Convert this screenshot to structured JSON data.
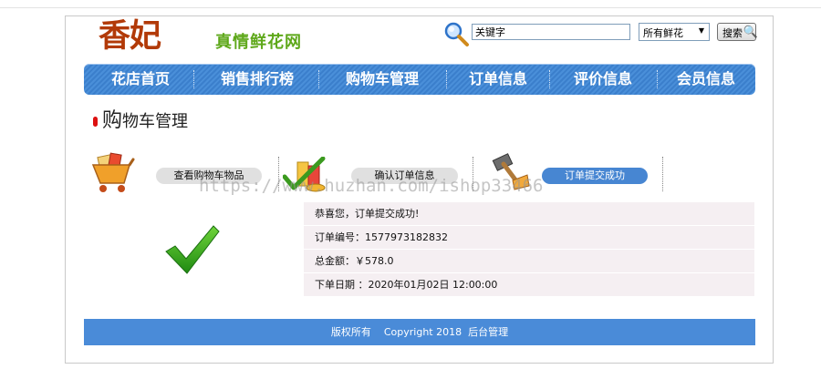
{
  "header": {
    "logo_main": "香妃",
    "logo_sub": "真情鲜花网",
    "search_placeholder": "关键字",
    "category_selected": "所有鲜花",
    "search_button": "搜索"
  },
  "nav": {
    "items": [
      {
        "label": "花店首页"
      },
      {
        "label": "销售排行榜"
      },
      {
        "label": "购物车管理"
      },
      {
        "label": "订单信息"
      },
      {
        "label": "评价信息"
      },
      {
        "label": "会员信息"
      }
    ]
  },
  "page": {
    "title_first": "购",
    "title_rest": "物车管理"
  },
  "steps": [
    {
      "label": "查看购物车物品",
      "active": false
    },
    {
      "label": "确认订单信息",
      "active": false
    },
    {
      "label": "订单提交成功",
      "active": true
    }
  ],
  "watermark": "https://www.huzhan.com/ishop33466",
  "order": {
    "message": "恭喜您，订单提交成功!",
    "number_label": "订单编号：",
    "number": "1577973182832",
    "total_label": "总金额：",
    "total": "￥578.0",
    "date_label": "下单日期 ：",
    "date": "2020年01月02日 12:00:00"
  },
  "footer": {
    "rights": "版权所有",
    "copyright": "Copyright 2018",
    "admin_link": "后台管理"
  },
  "colors": {
    "nav_blue": "#3b7fcc",
    "footer_blue": "#4a8bd8",
    "active_step": "#4786d2",
    "logo_red": "#b23a08",
    "logo_green": "#5ea81a",
    "check_green": "#3aa61c"
  }
}
